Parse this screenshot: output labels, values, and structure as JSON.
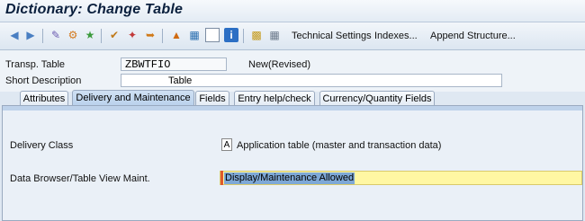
{
  "window": {
    "title": "Dictionary: Change Table"
  },
  "toolbar": {
    "icons": [
      "back-arrow-icon",
      "forward-arrow-icon",
      "other-object-icon",
      "display-change-icon",
      "activate-icon",
      "check-icon",
      "where-used-icon",
      "object-list-icon",
      "hierarchy-icon",
      "table-icon",
      "info-icon",
      "append-structure-icon",
      "grid-icon"
    ],
    "buttons": [
      "Technical Settings",
      "Indexes...",
      "Append Structure..."
    ]
  },
  "header": {
    "transp_table_label": "Transp. Table",
    "transp_table_value": "ZBWTFIO",
    "status": "New(Revised)",
    "short_desc_label": "Short Description",
    "short_desc_value": "Table"
  },
  "tabs": [
    {
      "label": "Attributes"
    },
    {
      "label": "Delivery and Maintenance",
      "active": true
    },
    {
      "label": "Fields"
    },
    {
      "label": "Entry help/check"
    },
    {
      "label": "Currency/Quantity Fields"
    }
  ],
  "form": {
    "delivery_class_label": "Delivery Class",
    "delivery_class_value": "A",
    "delivery_class_desc": "Application table (master and transaction data)",
    "browser_label": "Data Browser/Table View Maint.",
    "browser_value": "Display/Maintenance Allowed"
  },
  "colors": {
    "accent": "#b9d1ec",
    "highlight": "#fff7a3",
    "selection": "#7ea8d6"
  }
}
